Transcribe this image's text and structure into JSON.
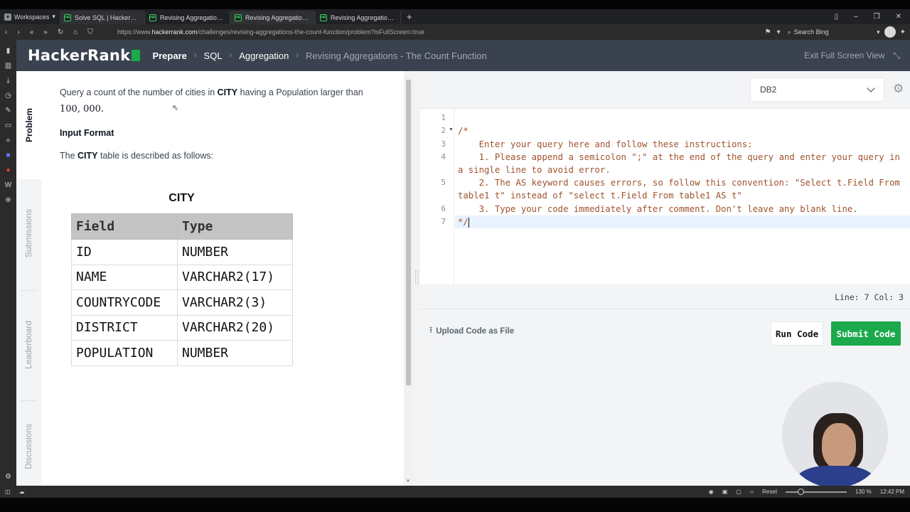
{
  "browser": {
    "workspaces_label": "Workspaces",
    "tabs": [
      {
        "title": "Solve SQL | HackerRank"
      },
      {
        "title": "Revising Aggregations - Th"
      },
      {
        "title": "Revising Aggregations - Th"
      },
      {
        "title": "Revising Aggregations - Av"
      }
    ],
    "url_prefix": "https://www.",
    "url_domain": "hackerrank.com",
    "url_path": "/challenges/revising-aggregations-the-count-function/problem?isFullScreen=true",
    "search_placeholder": "Search Bing",
    "status": {
      "reset": "Reset",
      "zoom": "130 %",
      "time": "12:42 PM"
    }
  },
  "header": {
    "logo": "HackerRank",
    "breadcrumbs": [
      "Prepare",
      "SQL",
      "Aggregation",
      "Revising Aggregations - The Count Function"
    ],
    "exit_fullscreen": "Exit Full Screen View"
  },
  "side_tabs": [
    "Problem",
    "Submissions",
    "Leaderboard",
    "Discussions"
  ],
  "problem": {
    "statement_pre": "Query a count of the number of cities in ",
    "statement_table": "CITY",
    "statement_post": " having a Population larger than",
    "threshold": "100, 000.",
    "input_format_heading": "Input Format",
    "described_pre": "The ",
    "described_table": "CITY",
    "described_post": " table is described as follows:",
    "table_caption": "CITY",
    "table_headers": [
      "Field",
      "Type"
    ],
    "table_rows": [
      [
        "ID",
        "NUMBER"
      ],
      [
        "NAME",
        "VARCHAR2(17)"
      ],
      [
        "COUNTRYCODE",
        "VARCHAR2(3)"
      ],
      [
        "DISTRICT",
        "VARCHAR2(20)"
      ],
      [
        "POPULATION",
        "NUMBER"
      ]
    ]
  },
  "editor": {
    "language": "DB2",
    "line_numbers": [
      "1",
      "2",
      "3",
      "4",
      "5",
      "6",
      "7"
    ],
    "lines": [
      "",
      "/*",
      "    Enter your query here and follow these instructions:",
      "    1. Please append a semicolon \";\" at the end of the query and enter your query in a single line to avoid error.",
      "    2. The AS keyword causes errors, so follow this convention: \"Select t.Field From table1 t\" instead of \"select t.Field From table1 AS t\"",
      "    3. Type your code immediately after comment. Don't leave any blank line.",
      "*/"
    ],
    "status": "Line: 7 Col: 3",
    "upload_label": "Upload Code as File",
    "run_label": "Run Code",
    "submit_label": "Submit Code"
  },
  "colors": {
    "brand_green": "#1ba94c",
    "header_bg": "#39424e",
    "comment": "#a0522d"
  }
}
